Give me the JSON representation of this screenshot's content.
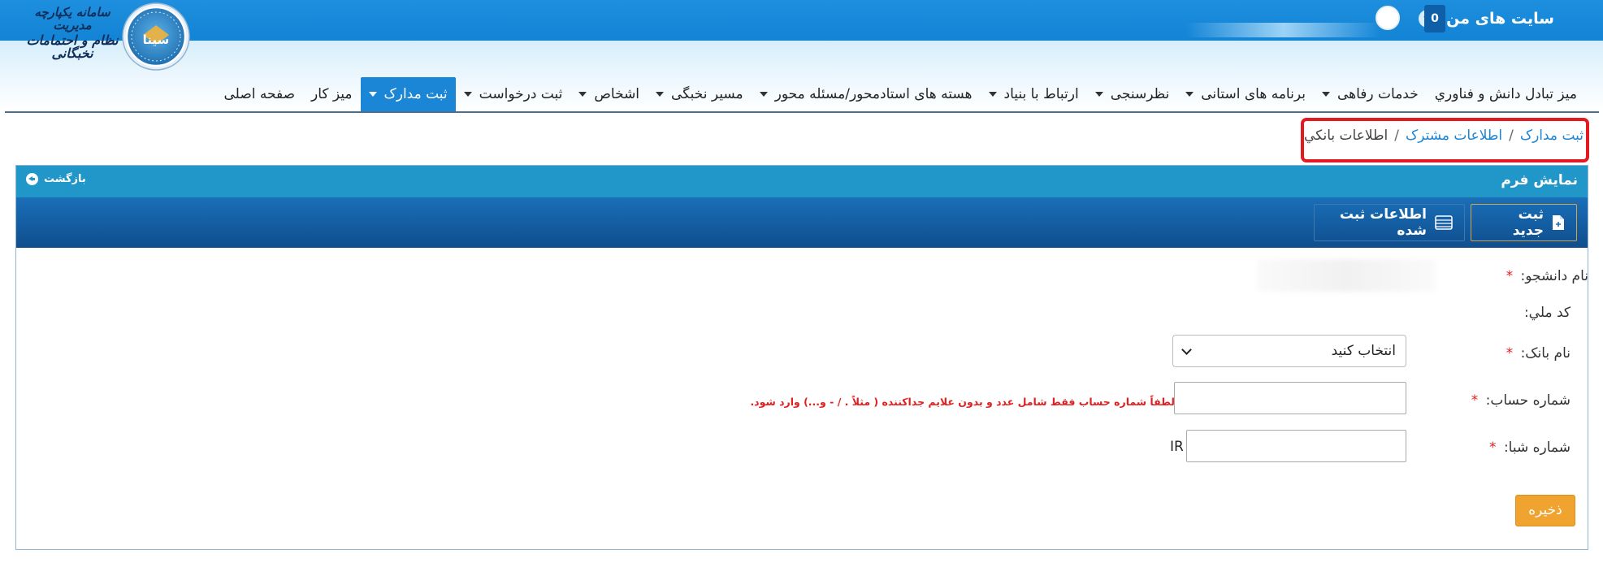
{
  "topbar": {
    "my_sites_label": "سایت های من",
    "notification_count": "0"
  },
  "logo": {
    "emblem_text": "سینا",
    "line1": "سامانه یکپارچه مدیریت",
    "line2": "نظام و احتمامات نخبگانی"
  },
  "nav": {
    "items": [
      {
        "label": "صفحه اصلی",
        "has_caret": false,
        "active": false
      },
      {
        "label": "میز کار",
        "has_caret": false,
        "active": false
      },
      {
        "label": "ثبت مدارک",
        "has_caret": true,
        "active": true
      },
      {
        "label": "ثبت درخواست",
        "has_caret": true,
        "active": false
      },
      {
        "label": "اشخاص",
        "has_caret": true,
        "active": false
      },
      {
        "label": "مسیر نخبگی",
        "has_caret": true,
        "active": false
      },
      {
        "label": "هسته های استادمحور/مسئله محور",
        "has_caret": true,
        "active": false
      },
      {
        "label": "ارتباط با بنیاد",
        "has_caret": true,
        "active": false
      },
      {
        "label": "نظرسنجی",
        "has_caret": true,
        "active": false
      },
      {
        "label": "برنامه های استانی",
        "has_caret": true,
        "active": false
      },
      {
        "label": "خدمات رفاهی",
        "has_caret": true,
        "active": false
      },
      {
        "label": "میز تبادل دانش و فناوري",
        "has_caret": false,
        "active": false
      }
    ]
  },
  "breadcrumb": {
    "items": [
      "ثبت مدارک",
      "اطلاعات مشترک",
      "اطلاعات بانکي"
    ],
    "separator": "/"
  },
  "panel": {
    "title": "نمایش فرم",
    "back_label": "بازگشت"
  },
  "toolbar": {
    "new_label": "ثبت جدید",
    "registered_label": "اطلاعات ثبت شده"
  },
  "form": {
    "required_mark": "*",
    "student_name_label": "نام دانشجو:",
    "national_code_label": "کد ملي:",
    "bank_name_label": "نام بانک:",
    "bank_select_value": "انتخاب کنید",
    "account_number_label": "شماره حساب:",
    "account_hint": "لطفاً شماره حساب فقط شامل عدد و بدون علایم جداکننده ( مثلاً . / - و...) وارد شود.",
    "sheba_label": "شماره شبا:",
    "sheba_prefix": "IR",
    "save_label": "ذخیره"
  },
  "colors": {
    "topbar": "#1383d5",
    "nav_active": "#1b86d6",
    "panel_head": "#2196c9",
    "toolbar": "#0f4e8e",
    "highlight_border": "#e31a22",
    "required": "#e02020",
    "save_button": "#f0a32e",
    "link": "#1a86d6"
  }
}
